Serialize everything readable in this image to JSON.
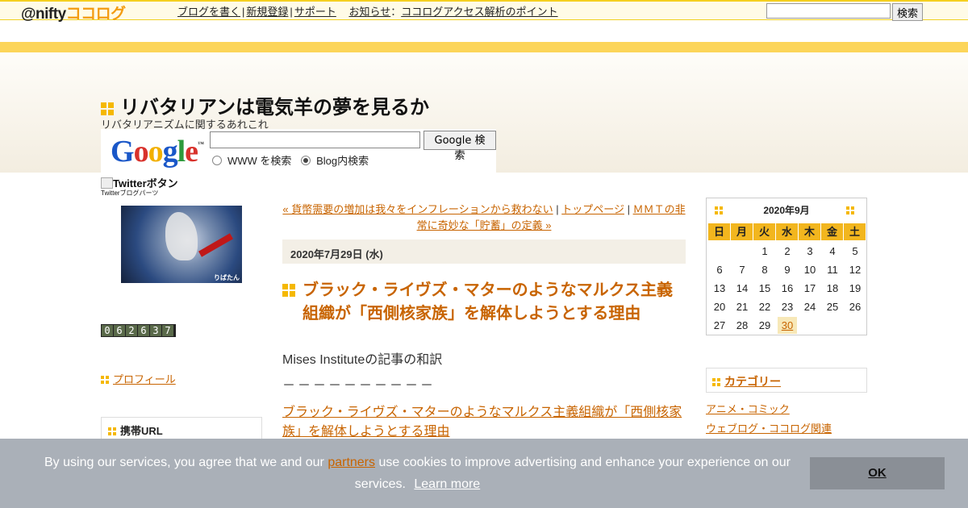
{
  "topbar": {
    "logo_prefix": "@nifty",
    "logo_brand": "ココログ",
    "nav": [
      "ブログを書く",
      "新規登録",
      "サポート"
    ],
    "news_label": "お知らせ",
    "news_colon": "：",
    "news_link": "ココログアクセス解析のポイント",
    "search_value": "",
    "search_button": "検索"
  },
  "blog": {
    "title": "リバタリアンは電気羊の夢を見るか",
    "description": "リバタリアニズムに関するあれこれ"
  },
  "google_search": {
    "logo": "Google",
    "tm": "™",
    "input_value": "",
    "button": "Google 検索",
    "option_www": "WWW を検索",
    "option_blog": "Blog内検索"
  },
  "sidebar_left": {
    "twitter_alt": "Twitterボタン",
    "twitter_parts": "Twitterブログパーツ",
    "avatar_label": "りばたん",
    "counter_digits": [
      "0",
      "6",
      "2",
      "6",
      "3",
      "7"
    ],
    "profile_link": "プロフィール",
    "mobile_url_heading": "携帯URL"
  },
  "post": {
    "nav_prev": "« 貨幣需要の増加は我々をインフレーションから救わない",
    "nav_sep1": " | ",
    "nav_top": "トップページ",
    "nav_sep2": " | ",
    "nav_next": "ＭＭＴの非常に奇妙な「貯蓄」の定義 »",
    "date": "2020年7月29日 (水)",
    "title": "ブラック・ライヴズ・マターのようなマルクス主義組織が「西側核家族」を解体しようとする理由",
    "intro": "Mises Instituteの記事の和訳",
    "divider": "－－－－－－－－－－",
    "link": "ブラック・ライヴズ・マターのようなマルクス主義組織が「西側核家族」を解体しようとする理由"
  },
  "calendar": {
    "title": "2020年9月",
    "weekdays": [
      "日",
      "月",
      "火",
      "水",
      "木",
      "金",
      "土"
    ],
    "leading_blanks": 2,
    "days": [
      1,
      2,
      3,
      4,
      5,
      6,
      7,
      8,
      9,
      10,
      11,
      12,
      13,
      14,
      15,
      16,
      17,
      18,
      19,
      20,
      21,
      22,
      23,
      24,
      25,
      26,
      27,
      28,
      29,
      30
    ],
    "linked_day": 30
  },
  "categories": {
    "heading": "カテゴリー",
    "items": [
      "アニメ・コミック",
      "ウェブログ・ココログ関連"
    ]
  },
  "cookie": {
    "text_before": "By using our services, you agree that we and our ",
    "partners": "partners",
    "text_after": " use cookies to improve advertising and enhance your experience on our services.",
    "learn_more": "Learn more",
    "ok": "OK"
  },
  "colors": {
    "accent": "#f5b800",
    "link": "#c86400",
    "stripe": "#fcd55a",
    "cookie_bg": "#aab0b8"
  }
}
